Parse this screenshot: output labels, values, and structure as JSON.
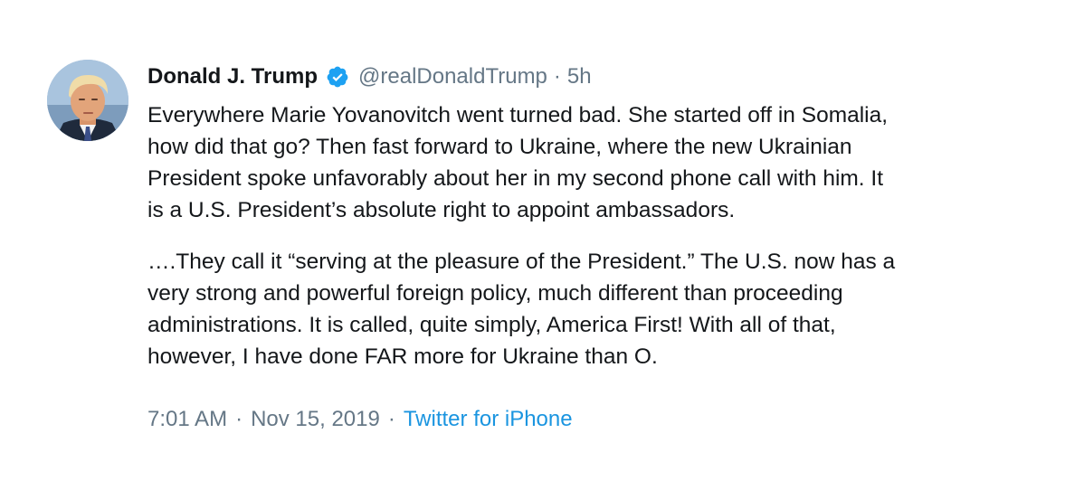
{
  "author": {
    "display_name": "Donald J. Trump",
    "handle": "@realDonaldTrump",
    "separator": "·",
    "time_ago": "5h",
    "verified": true
  },
  "tweet": {
    "paragraph1": [
      "Everywhere Marie Yovanovitch went turned bad. She started off in Somalia,",
      "how did that go? Then fast forward to Ukraine, where the new Ukrainian",
      "President spoke unfavorably about her in my second phone call with him. It",
      "is a U.S. President’s absolute right to appoint ambassadors."
    ],
    "paragraph2": [
      "….They call it “serving at the pleasure of the President.” The U.S. now has a",
      "very strong and powerful foreign policy, much different than proceeding",
      "administrations. It is called, quite simply, America First! With all of that,",
      "however, I have done FAR more for Ukraine than O."
    ]
  },
  "footer": {
    "time": "7:01 AM",
    "date": "Nov 15, 2019",
    "separator": "·",
    "source": "Twitter for iPhone"
  },
  "colors": {
    "text": "#14171a",
    "secondary": "#657786",
    "link": "#1b95e0",
    "verified": "#1da1f2"
  },
  "icons": {
    "verified": "verified-badge-icon",
    "avatar": "profile-photo"
  }
}
